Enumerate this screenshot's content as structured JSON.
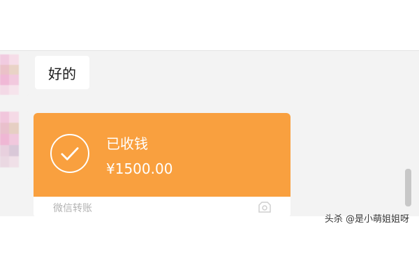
{
  "message": {
    "text": "好的"
  },
  "transfer": {
    "status": "已收钱",
    "amount": "¥1500.00",
    "footer_label": "微信转账",
    "icon": "check-circle-icon",
    "accent_color": "#f9a03f"
  },
  "watermark": {
    "text": "头杀 @是小萌姐姐呀"
  }
}
